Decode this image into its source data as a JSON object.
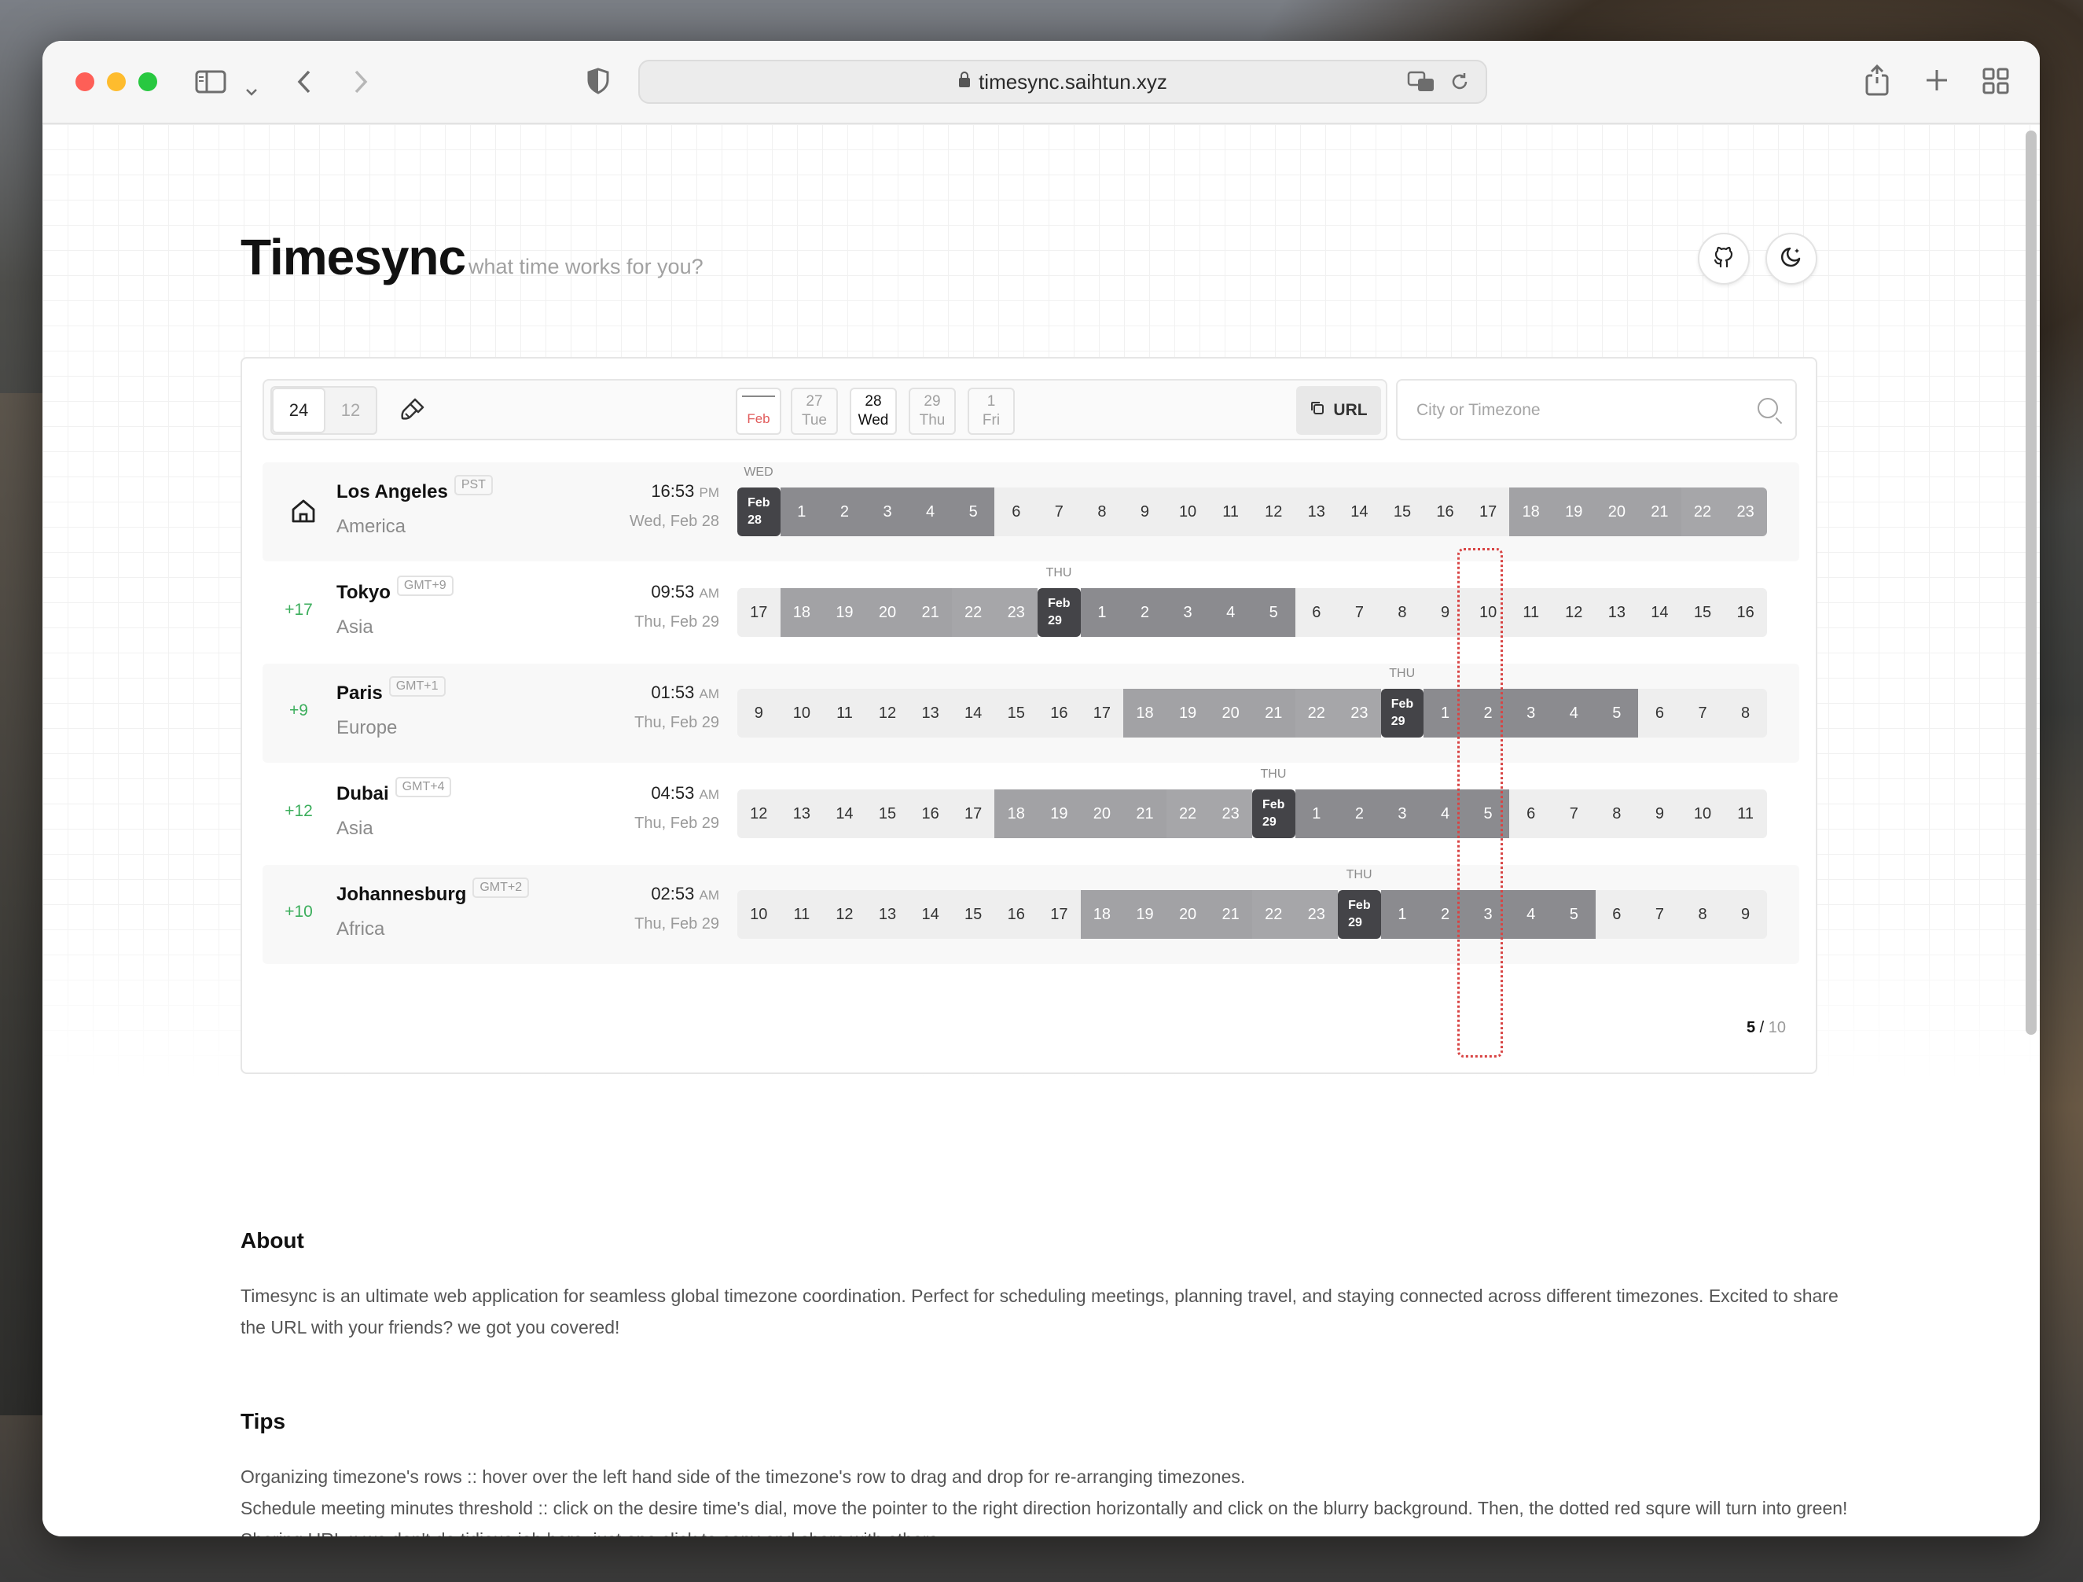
{
  "browser": {
    "url": "timesync.saihtun.xyz"
  },
  "header": {
    "title": "Timesync",
    "subtitle": "what time works for you?"
  },
  "controls": {
    "format_24": "24",
    "format_12": "12",
    "calendar_month": "Feb",
    "days": [
      {
        "num": "27",
        "dow": "Tue",
        "active": false
      },
      {
        "num": "28",
        "dow": "Wed",
        "active": true
      },
      {
        "num": "29",
        "dow": "Thu",
        "active": false
      },
      {
        "num": "1",
        "dow": "Fri",
        "active": false
      }
    ],
    "url_button": "URL",
    "search_placeholder": "City or Timezone"
  },
  "rows": [
    {
      "offset": "",
      "home": true,
      "city": "Los Angeles",
      "tz": "PST",
      "region": "America",
      "time": "16:53",
      "ampm": "PM",
      "date": "Wed, Feb 28",
      "day_label": "WED",
      "day_label_index": 0,
      "hours": [
        "Feb|28",
        "1",
        "2",
        "3",
        "4",
        "5",
        "6",
        "7",
        "8",
        "9",
        "10",
        "11",
        "12",
        "13",
        "14",
        "15",
        "16",
        "17",
        "18",
        "19",
        "20",
        "21",
        "22",
        "23"
      ]
    },
    {
      "offset": "+17",
      "home": false,
      "city": "Tokyo",
      "tz": "GMT+9",
      "region": "Asia",
      "time": "09:53",
      "ampm": "AM",
      "date": "Thu, Feb 29",
      "day_label": "THU",
      "day_label_index": 7,
      "hours": [
        "17",
        "18",
        "19",
        "20",
        "21",
        "22",
        "23",
        "Feb|29",
        "1",
        "2",
        "3",
        "4",
        "5",
        "6",
        "7",
        "8",
        "9",
        "10",
        "11",
        "12",
        "13",
        "14",
        "15",
        "16"
      ]
    },
    {
      "offset": "+9",
      "home": false,
      "city": "Paris",
      "tz": "GMT+1",
      "region": "Europe",
      "time": "01:53",
      "ampm": "AM",
      "date": "Thu, Feb 29",
      "day_label": "THU",
      "day_label_index": 15,
      "hours": [
        "9",
        "10",
        "11",
        "12",
        "13",
        "14",
        "15",
        "16",
        "17",
        "18",
        "19",
        "20",
        "21",
        "22",
        "23",
        "Feb|29",
        "1",
        "2",
        "3",
        "4",
        "5",
        "6",
        "7",
        "8"
      ]
    },
    {
      "offset": "+12",
      "home": false,
      "city": "Dubai",
      "tz": "GMT+4",
      "region": "Asia",
      "time": "04:53",
      "ampm": "AM",
      "date": "Thu, Feb 29",
      "day_label": "THU",
      "day_label_index": 12,
      "hours": [
        "12",
        "13",
        "14",
        "15",
        "16",
        "17",
        "18",
        "19",
        "20",
        "21",
        "22",
        "23",
        "Feb|29",
        "1",
        "2",
        "3",
        "4",
        "5",
        "6",
        "7",
        "8",
        "9",
        "10",
        "11"
      ]
    },
    {
      "offset": "+10",
      "home": false,
      "city": "Johannesburg",
      "tz": "GMT+2",
      "region": "Africa",
      "time": "02:53",
      "ampm": "AM",
      "date": "Thu, Feb 29",
      "day_label": "THU",
      "day_label_index": 14,
      "hours": [
        "10",
        "11",
        "12",
        "13",
        "14",
        "15",
        "16",
        "17",
        "18",
        "19",
        "20",
        "21",
        "22",
        "23",
        "Feb|29",
        "1",
        "2",
        "3",
        "4",
        "5",
        "6",
        "7",
        "8",
        "9"
      ]
    }
  ],
  "pager": {
    "current": "5",
    "sep": " / ",
    "total": "10"
  },
  "about": {
    "heading": "About",
    "text": "Timesync is an ultimate web application for seamless global timezone coordination. Perfect for scheduling meetings, planning travel, and staying connected across different timezones. Excited to share the URL with your friends? we got you covered!"
  },
  "tips": {
    "heading": "Tips",
    "items": [
      "Organizing timezone's rows :: hover over the left hand side of the timezone's row to drag and drop for re-arranging timezones.",
      "Schedule meeting minutes threshold :: click on the desire time's dial, move the pointer to the right direction horizontally and click on the blurry background. Then, the dotted red squre will turn into green!",
      "Sharing URL :: we don't do tidious job here, just one click to copy and share with others."
    ]
  },
  "colors": {
    "day": "#eeeeee",
    "evening": "#a2a2a5",
    "night": "#8b8b8f",
    "midnight": "#444448",
    "offset_green": "#3cae5c",
    "selection_red": "#d84444"
  }
}
